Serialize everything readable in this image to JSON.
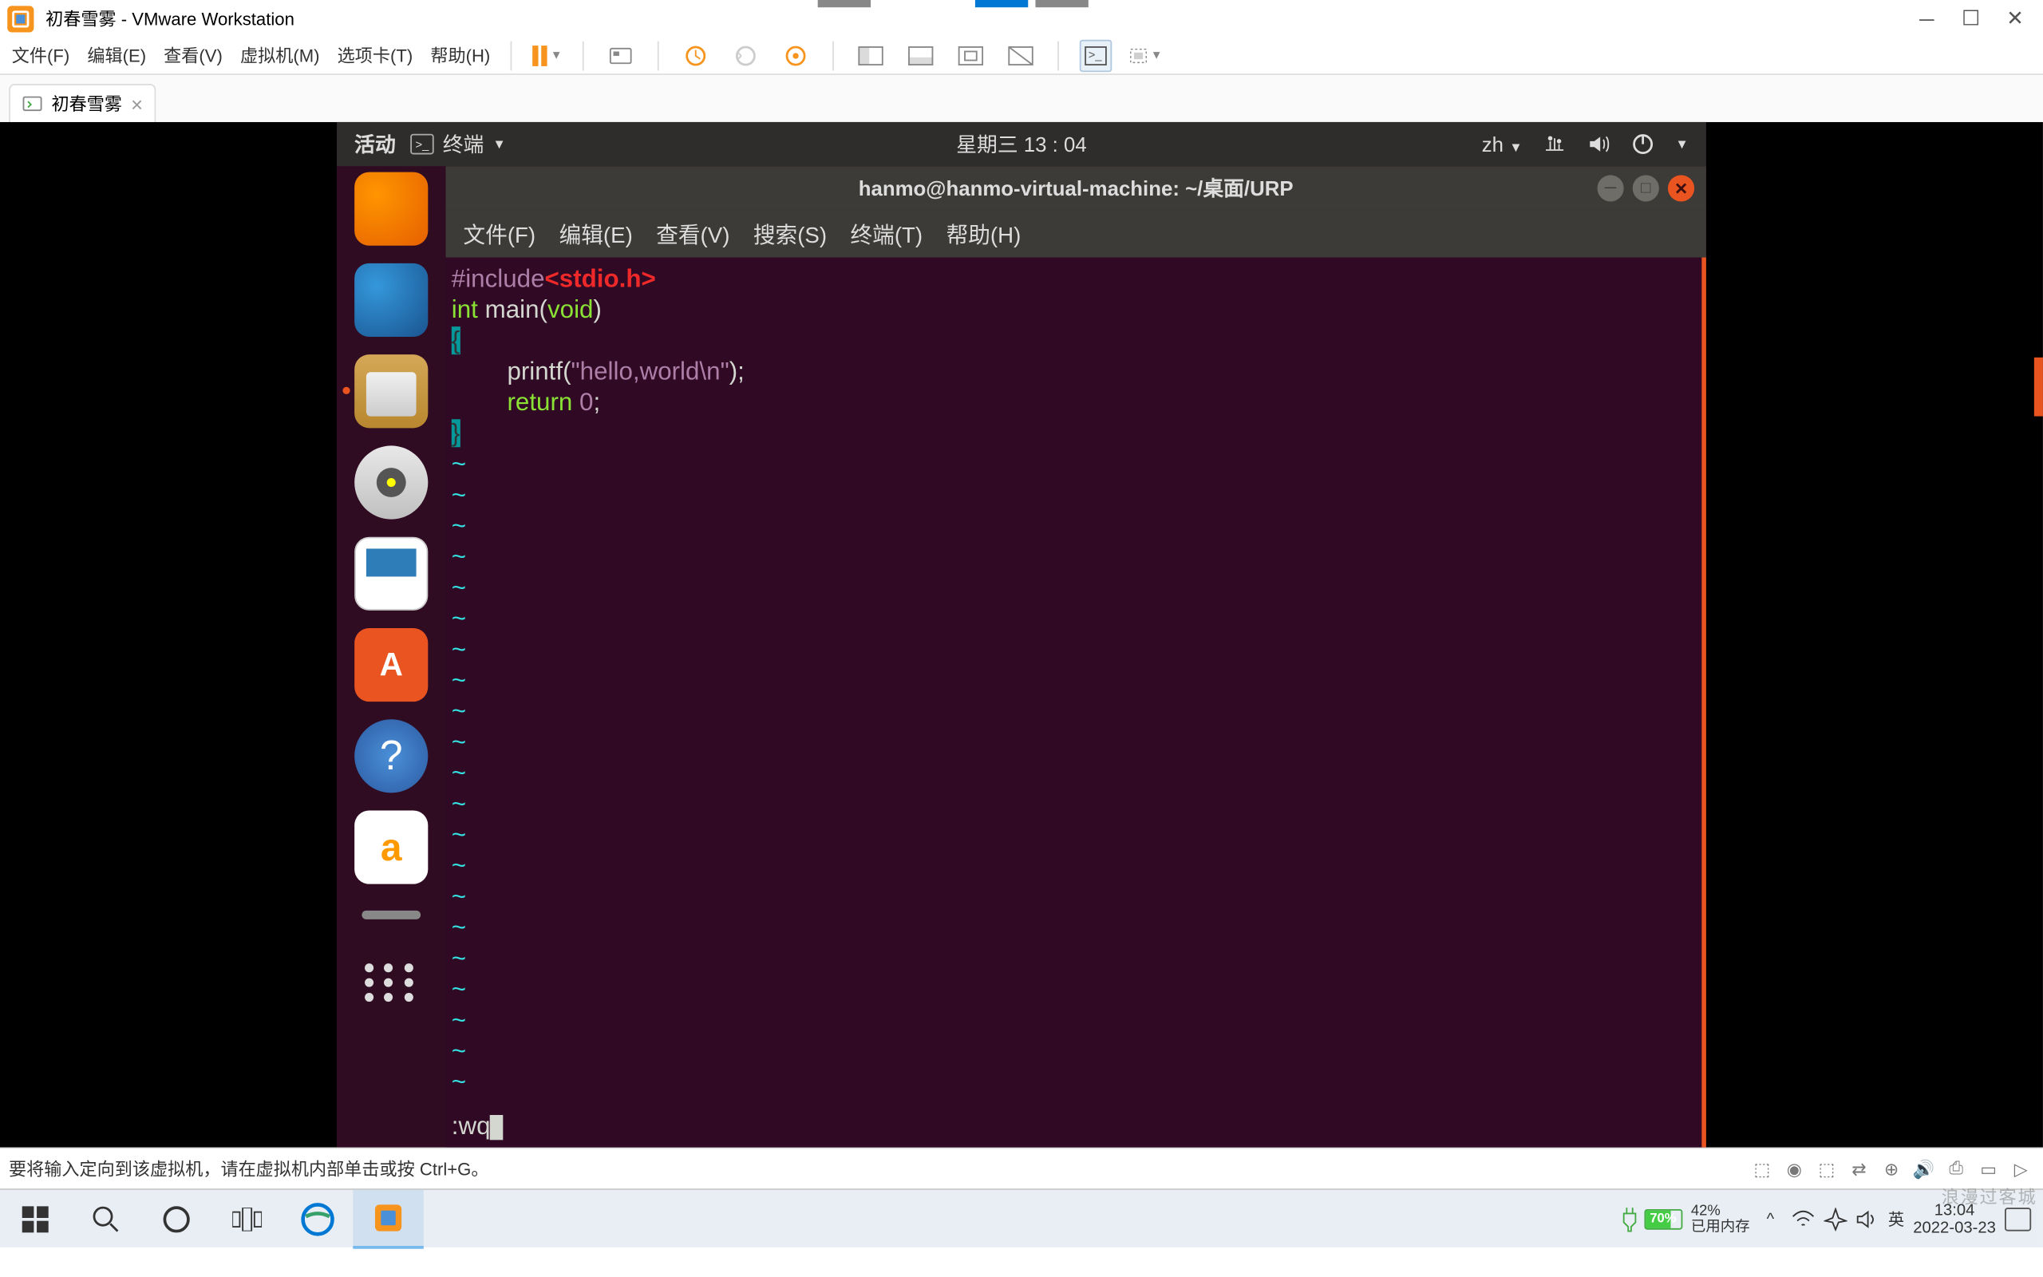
{
  "vmware": {
    "title": "初春雪雾 - VMware Workstation",
    "menu": {
      "file": "文件(F)",
      "edit": "编辑(E)",
      "view": "查看(V)",
      "vm": "虚拟机(M)",
      "tabs": "选项卡(T)",
      "help": "帮助(H)"
    },
    "tab": {
      "name": "初春雪雾"
    },
    "status": "要将输入定向到该虚拟机，请在虚拟机内部单击或按 Ctrl+G。"
  },
  "ubuntu": {
    "topbar": {
      "activities": "活动",
      "terminal": "终端",
      "datetime": "星期三 13 : 04",
      "ime": "zh"
    },
    "terminal": {
      "title": "hanmo@hanmo-virtual-machine: ~/桌面/URP",
      "menu": {
        "file": "文件(F)",
        "edit": "编辑(E)",
        "view": "查看(V)",
        "search": "搜索(S)",
        "terminal": "终端(T)",
        "help": "帮助(H)"
      },
      "code": {
        "l1a": "#include",
        "l1b": "<stdio.h>",
        "l2a": "int ",
        "l2b": "main",
        "l2c": "(",
        "l2d": "void",
        "l2e": ")",
        "l3": "{",
        "l4a": "        printf(",
        "l4b": "\"hello,world\\n\"",
        "l4c": ");",
        "l5a": "        ",
        "l5b": "return ",
        "l5c": "0",
        "l5d": ";",
        "l6": "}",
        "tilde": "~",
        "cmd": ":wq"
      }
    }
  },
  "windows": {
    "battery": {
      "pct": "70%",
      "mem_pct": "42%",
      "mem_label": "已用内存"
    },
    "ime": "英",
    "clock": {
      "time": "13:04",
      "date": "2022-03-23"
    }
  },
  "watermark": "浪漫过客城"
}
